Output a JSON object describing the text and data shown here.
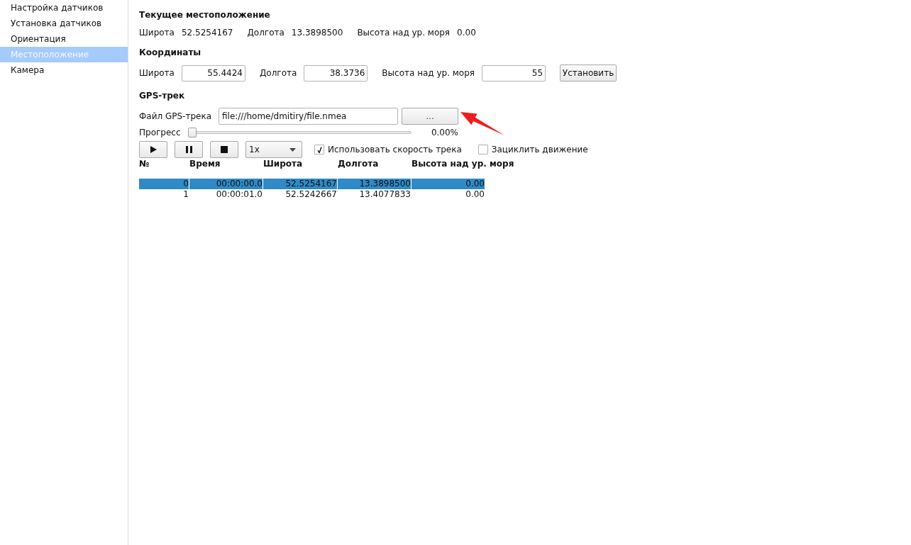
{
  "sidebar": {
    "items": [
      {
        "label": "Настройка датчиков",
        "selected": false
      },
      {
        "label": "Установка датчиков",
        "selected": false
      },
      {
        "label": "Ориентация",
        "selected": false
      },
      {
        "label": "Местоположение",
        "selected": true
      },
      {
        "label": "Камера",
        "selected": false
      }
    ]
  },
  "current_location": {
    "title": "Текущее местоположение",
    "fields": [
      {
        "label": "Широта",
        "value": "52.5254167"
      },
      {
        "label": "Долгота",
        "value": "13.3898500"
      },
      {
        "label": "Высота над ур. моря",
        "value": "0.00"
      }
    ]
  },
  "coordinates": {
    "title": "Координаты",
    "fields": [
      {
        "label": "Широта",
        "value": "55.4424"
      },
      {
        "label": "Долгота",
        "value": "38.3736"
      },
      {
        "label": "Высота над ур. моря",
        "value": "55"
      }
    ],
    "button": "Установить"
  },
  "gps_track": {
    "title": "GPS-трек",
    "file_label": "Файл GPS-трека",
    "file_path": "file:///home/dmitiry/file.nmea",
    "browse_button": "...",
    "progress_label": "Прогресс",
    "progress": {
      "level": 0
    },
    "progress_reading": "0.00%",
    "playback_buttons": [
      {
        "kind": "play"
      },
      {
        "kind": "pause"
      },
      {
        "kind": "stop"
      }
    ],
    "speed": "1x",
    "options": [
      {
        "label": "Использовать скорость трека",
        "checked": true
      },
      {
        "label": "Зациклить движение",
        "checked": false
      }
    ]
  },
  "table": {
    "columns": [
      "№",
      "Время",
      "Широта",
      "Долгота",
      "Высота над ур. моря"
    ],
    "rows": [
      {
        "cells": [
          "0",
          "00:00:00.0",
          "52.5254167",
          "13.3898500",
          "0.00"
        ],
        "selected": true
      },
      {
        "cells": [
          "1",
          "00:00:01.0",
          "52.5242667",
          "13.4077833",
          "0.00"
        ],
        "selected": false
      }
    ]
  }
}
